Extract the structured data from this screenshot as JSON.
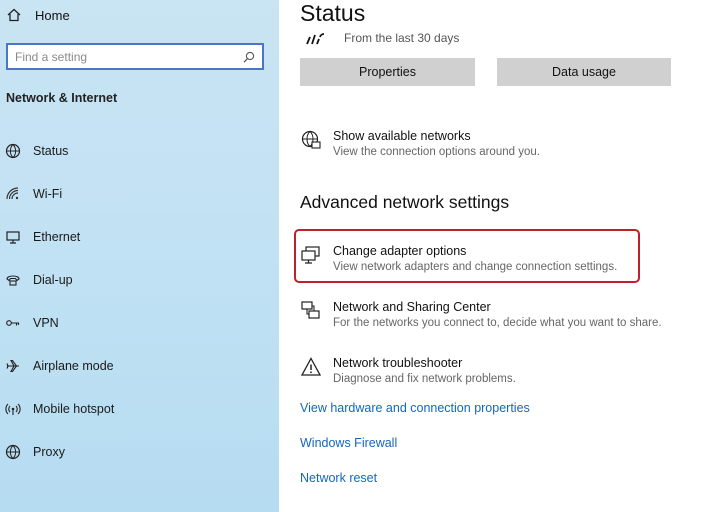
{
  "sidebar": {
    "home_label": "Home",
    "search_placeholder": "Find a setting",
    "section_title": "Network & Internet",
    "items": [
      {
        "label": "Status",
        "icon": "status-icon"
      },
      {
        "label": "Wi-Fi",
        "icon": "wifi-icon"
      },
      {
        "label": "Ethernet",
        "icon": "ethernet-icon"
      },
      {
        "label": "Dial-up",
        "icon": "dialup-icon"
      },
      {
        "label": "VPN",
        "icon": "vpn-icon"
      },
      {
        "label": "Airplane mode",
        "icon": "airplane-icon"
      },
      {
        "label": "Mobile hotspot",
        "icon": "hotspot-icon"
      },
      {
        "label": "Proxy",
        "icon": "proxy-icon"
      }
    ]
  },
  "main": {
    "title": "Status",
    "usage_text": "From the last 30 days",
    "buttons": {
      "properties": "Properties",
      "data_usage": "Data usage"
    },
    "show_networks": {
      "title": "Show available networks",
      "desc": "View the connection options around you."
    },
    "advanced_heading": "Advanced network settings",
    "adapter": {
      "title": "Change adapter options",
      "desc": "View network adapters and change connection settings."
    },
    "sharing": {
      "title": "Network and Sharing Center",
      "desc": "For the networks you connect to, decide what you want to share."
    },
    "troubleshooter": {
      "title": "Network troubleshooter",
      "desc": "Diagnose and fix network problems."
    },
    "links": {
      "hardware": "View hardware and connection properties",
      "firewall": "Windows Firewall",
      "reset": "Network reset"
    }
  },
  "colors": {
    "accent": "#1565c0",
    "highlight": "#c0202a",
    "sidebar_bg": "#c3e2f4",
    "button_bg": "#d0d0d0"
  }
}
